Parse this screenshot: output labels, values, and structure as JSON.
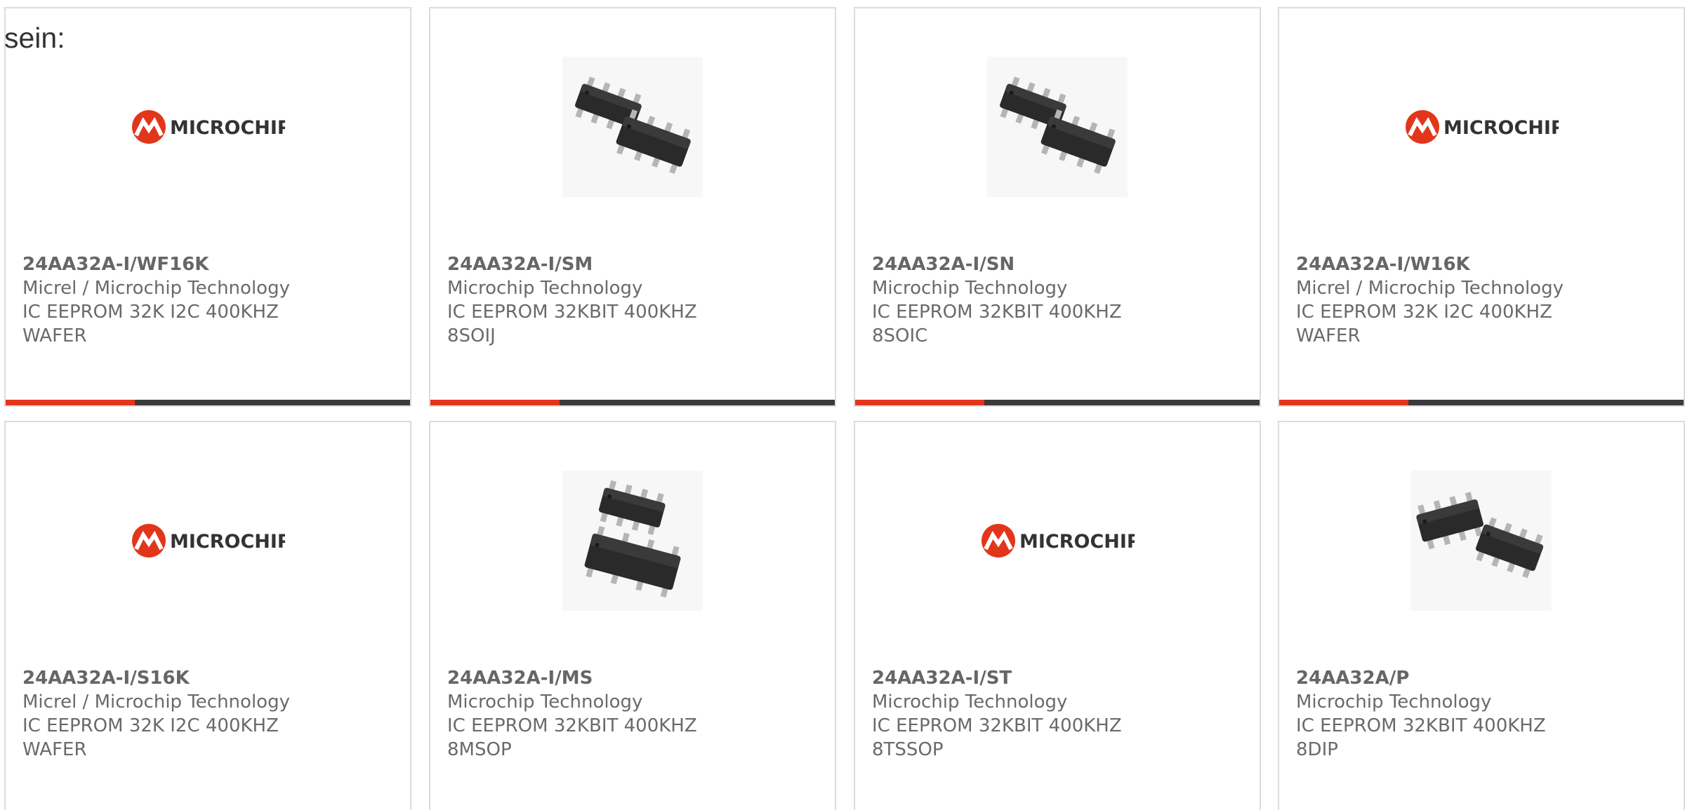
{
  "intro": "sein:",
  "products": [
    {
      "part": "24AA32A-I/WF16K",
      "manufacturer": "Micrel / Microchip Technology",
      "description": "IC EEPROM 32K I2C 400KHZ WAFER",
      "image": "microchip-logo",
      "logo_text": "MICROCHIP",
      "has_bar": true
    },
    {
      "part": "24AA32A-I/SM",
      "manufacturer": "Microchip Technology",
      "description": "IC EEPROM 32KBIT 400KHZ 8SOIJ",
      "image": "soic-chip-photo",
      "has_bar": true
    },
    {
      "part": "24AA32A-I/SN",
      "manufacturer": "Microchip Technology",
      "description": "IC EEPROM 32KBIT 400KHZ 8SOIC",
      "image": "soic-chip-photo",
      "has_bar": true
    },
    {
      "part": "24AA32A-I/W16K",
      "manufacturer": "Micrel / Microchip Technology",
      "description": "IC EEPROM 32K I2C 400KHZ WAFER",
      "image": "microchip-logo",
      "logo_text": "MICROCHIP",
      "has_bar": true
    },
    {
      "part": "24AA32A-I/S16K",
      "manufacturer": "Micrel / Microchip Technology",
      "description": "IC EEPROM 32K I2C 400KHZ WAFER",
      "image": "microchip-logo",
      "logo_text": "MICROCHIP",
      "has_bar": false
    },
    {
      "part": "24AA32A-I/MS",
      "manufacturer": "Microchip Technology",
      "description": "IC EEPROM 32KBIT 400KHZ 8MSOP",
      "image": "msop-chip-photo",
      "has_bar": false
    },
    {
      "part": "24AA32A-I/ST",
      "manufacturer": "Microchip Technology",
      "description": "IC EEPROM 32KBIT 400KHZ 8TSSOP",
      "image": "microchip-logo",
      "logo_text": "MICROCHIP",
      "has_bar": false
    },
    {
      "part": "24AA32A/P",
      "manufacturer": "Microchip Technology",
      "description": "IC EEPROM 32KBIT 400KHZ 8DIP",
      "image": "dip-chip-photo",
      "has_bar": false
    }
  ],
  "colors": {
    "accent": "#e2361b",
    "bar": "#3b3b3b",
    "border": "#dcdcdc",
    "text": "#6a6a6a"
  }
}
